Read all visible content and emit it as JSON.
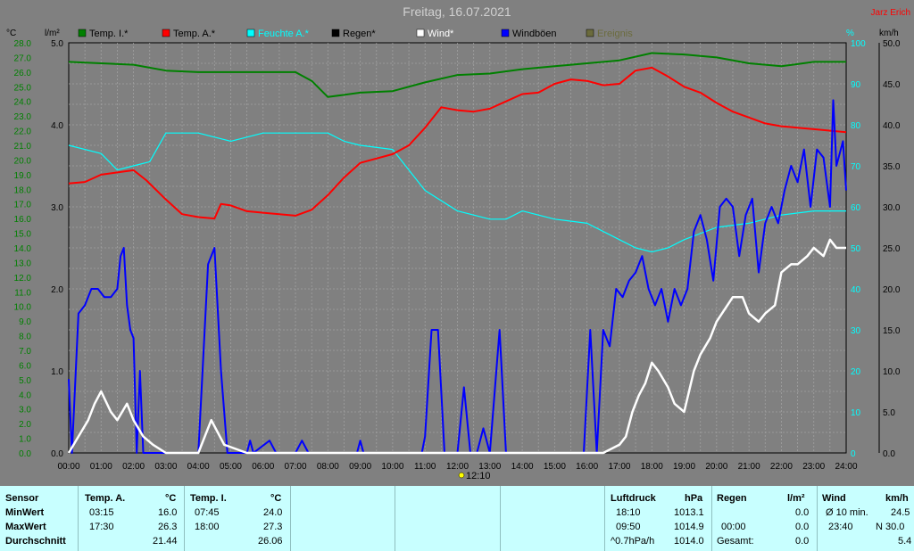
{
  "header": {
    "title": "Freitag, 16.07.2021",
    "author": "Jarz Erich",
    "unit_left_temp": "°C",
    "unit_left_rain": "l/m²",
    "unit_right_hum": "%",
    "unit_right_wind": "km/h",
    "sun_marker": "12:10"
  },
  "colors": {
    "background": "#808080",
    "grid": "#a0a0a0",
    "temp_axis": "#008000",
    "temp_in": "#008000",
    "temp_out": "#ff0000",
    "humidity": "#00ffff",
    "rain": "#000000",
    "wind": "#ffffff",
    "gust": "#0000ff",
    "lightning": "#6b6b3c",
    "table_bg": "#c8ffff"
  },
  "chart_data": {
    "type": "line",
    "legend": [
      "Temp. I.*",
      "Temp. A.*",
      "Feuchte A.*",
      "Regen*",
      "Wind*",
      "Windböen",
      "Ereignis"
    ],
    "x_ticks": [
      "00:00",
      "01:00",
      "02:00",
      "03:00",
      "04:00",
      "05:00",
      "06:00",
      "07:00",
      "08:00",
      "09:00",
      "10:00",
      "11:00",
      "12:00",
      "13:00",
      "14:00",
      "15:00",
      "16:00",
      "17:00",
      "18:00",
      "19:00",
      "20:00",
      "21:00",
      "22:00",
      "23:00",
      "24:00"
    ],
    "temp_ticks": [
      "0.0",
      "1.0",
      "2.0",
      "3.0",
      "4.0",
      "5.0",
      "6.0",
      "7.0",
      "8.0",
      "9.0",
      "10.0",
      "11.0",
      "12.0",
      "13.0",
      "14.0",
      "15.0",
      "16.0",
      "17.0",
      "18.0",
      "19.0",
      "20.0",
      "21.0",
      "22.0",
      "23.0",
      "24.0",
      "25.0",
      "26.0",
      "27.0",
      "28.0"
    ],
    "rain_ticks": [
      "0.0",
      "1.0",
      "2.0",
      "3.0",
      "4.0",
      "5.0"
    ],
    "hum_ticks": [
      "0",
      "10",
      "20",
      "30",
      "40",
      "50",
      "60",
      "70",
      "80",
      "90",
      "100"
    ],
    "wind_ticks": [
      "0.0",
      "5.0",
      "10.0",
      "15.0",
      "20.0",
      "25.0",
      "30.0",
      "35.0",
      "40.0",
      "45.0",
      "50.0"
    ],
    "temp_range": [
      0,
      28
    ],
    "hum_range": [
      0,
      100
    ],
    "wind_range": [
      0,
      50
    ],
    "grid": true,
    "series": [
      {
        "name": "Temp. I.*",
        "axis": "temp",
        "color": "#008000",
        "points": [
          [
            0,
            26.7
          ],
          [
            1,
            26.6
          ],
          [
            2,
            26.5
          ],
          [
            3,
            26.1
          ],
          [
            4,
            26.0
          ],
          [
            5,
            26.0
          ],
          [
            6,
            26.0
          ],
          [
            7,
            26.0
          ],
          [
            7.5,
            25.4
          ],
          [
            8,
            24.3
          ],
          [
            9,
            24.6
          ],
          [
            10,
            24.7
          ],
          [
            11,
            25.3
          ],
          [
            12,
            25.8
          ],
          [
            13,
            25.9
          ],
          [
            14,
            26.2
          ],
          [
            15,
            26.4
          ],
          [
            16,
            26.6
          ],
          [
            17,
            26.8
          ],
          [
            18,
            27.3
          ],
          [
            19,
            27.2
          ],
          [
            20,
            27.0
          ],
          [
            21,
            26.6
          ],
          [
            22,
            26.4
          ],
          [
            23,
            26.7
          ],
          [
            24,
            26.7
          ]
        ]
      },
      {
        "name": "Temp. A.*",
        "axis": "temp",
        "color": "#ff0000",
        "points": [
          [
            0,
            18.4
          ],
          [
            0.5,
            18.5
          ],
          [
            1,
            19.0
          ],
          [
            2,
            19.3
          ],
          [
            2.4,
            18.6
          ],
          [
            3,
            17.3
          ],
          [
            3.5,
            16.3
          ],
          [
            4,
            16.1
          ],
          [
            4.5,
            16.0
          ],
          [
            4.7,
            17.0
          ],
          [
            5,
            16.9
          ],
          [
            5.5,
            16.5
          ],
          [
            6,
            16.4
          ],
          [
            6.5,
            16.3
          ],
          [
            7,
            16.2
          ],
          [
            7.5,
            16.6
          ],
          [
            8,
            17.6
          ],
          [
            8.5,
            18.8
          ],
          [
            9,
            19.8
          ],
          [
            10,
            20.4
          ],
          [
            10.5,
            21.0
          ],
          [
            11,
            22.2
          ],
          [
            11.5,
            23.6
          ],
          [
            12,
            23.4
          ],
          [
            12.5,
            23.3
          ],
          [
            13,
            23.5
          ],
          [
            13.5,
            24.0
          ],
          [
            14,
            24.5
          ],
          [
            14.5,
            24.6
          ],
          [
            15,
            25.2
          ],
          [
            15.5,
            25.5
          ],
          [
            16,
            25.4
          ],
          [
            16.5,
            25.1
          ],
          [
            17,
            25.2
          ],
          [
            17.5,
            26.1
          ],
          [
            18,
            26.3
          ],
          [
            18.5,
            25.7
          ],
          [
            19,
            25.0
          ],
          [
            19.5,
            24.6
          ],
          [
            20,
            23.9
          ],
          [
            20.5,
            23.3
          ],
          [
            21,
            22.9
          ],
          [
            21.5,
            22.5
          ],
          [
            22,
            22.3
          ],
          [
            23,
            22.1
          ],
          [
            24,
            21.9
          ]
        ]
      },
      {
        "name": "Feuchte A.*",
        "axis": "hum",
        "color": "#00ffff",
        "points": [
          [
            0,
            75
          ],
          [
            1,
            73
          ],
          [
            1.5,
            69
          ],
          [
            2,
            70
          ],
          [
            2.5,
            71
          ],
          [
            3,
            78
          ],
          [
            3.5,
            78
          ],
          [
            4,
            78
          ],
          [
            4.5,
            77
          ],
          [
            5,
            76
          ],
          [
            6,
            78
          ],
          [
            7,
            78
          ],
          [
            7.5,
            78
          ],
          [
            8,
            78
          ],
          [
            8.5,
            76
          ],
          [
            9,
            75
          ],
          [
            10,
            74
          ],
          [
            11,
            64
          ],
          [
            12,
            59
          ],
          [
            13,
            57
          ],
          [
            13.5,
            57
          ],
          [
            14,
            59
          ],
          [
            15,
            57
          ],
          [
            16,
            56
          ],
          [
            17,
            52
          ],
          [
            17.5,
            50
          ],
          [
            18,
            49
          ],
          [
            18.5,
            50
          ],
          [
            19,
            52
          ],
          [
            20,
            55
          ],
          [
            21,
            56
          ],
          [
            21.5,
            57
          ],
          [
            22,
            58
          ],
          [
            23,
            59
          ],
          [
            24,
            59
          ]
        ]
      },
      {
        "name": "Wind*",
        "axis": "wind",
        "color": "#ffffff",
        "points": [
          [
            0,
            0
          ],
          [
            0.3,
            2
          ],
          [
            0.6,
            4
          ],
          [
            0.8,
            6
          ],
          [
            1,
            7.5
          ],
          [
            1.3,
            5
          ],
          [
            1.5,
            4
          ],
          [
            1.8,
            6
          ],
          [
            2,
            4
          ],
          [
            2.3,
            2
          ],
          [
            2.6,
            1
          ],
          [
            3,
            0
          ],
          [
            4,
            0
          ],
          [
            4.4,
            4
          ],
          [
            4.8,
            1
          ],
          [
            5.5,
            0
          ],
          [
            16.5,
            0
          ],
          [
            17,
            1
          ],
          [
            17.2,
            2
          ],
          [
            17.4,
            5
          ],
          [
            17.6,
            7
          ],
          [
            17.8,
            8.5
          ],
          [
            18,
            11
          ],
          [
            18.2,
            10
          ],
          [
            18.5,
            8
          ],
          [
            18.7,
            6
          ],
          [
            19,
            5
          ],
          [
            19.3,
            10
          ],
          [
            19.5,
            12
          ],
          [
            19.8,
            14
          ],
          [
            20,
            16
          ],
          [
            20.5,
            19
          ],
          [
            20.8,
            19
          ],
          [
            21,
            17
          ],
          [
            21.3,
            16
          ],
          [
            21.5,
            17
          ],
          [
            21.8,
            18
          ],
          [
            22,
            22
          ],
          [
            22.3,
            23
          ],
          [
            22.5,
            23
          ],
          [
            22.8,
            24
          ],
          [
            23,
            25
          ],
          [
            23.3,
            24
          ],
          [
            23.5,
            26
          ],
          [
            23.7,
            25
          ],
          [
            24,
            25
          ]
        ]
      },
      {
        "name": "Windböen",
        "axis": "wind",
        "color": "#0000ff",
        "points": [
          [
            0,
            9
          ],
          [
            0.1,
            0
          ],
          [
            0.3,
            17
          ],
          [
            0.5,
            18
          ],
          [
            0.7,
            20
          ],
          [
            0.9,
            20
          ],
          [
            1.1,
            19
          ],
          [
            1.3,
            19
          ],
          [
            1.5,
            20
          ],
          [
            1.6,
            24
          ],
          [
            1.7,
            25
          ],
          [
            1.8,
            18
          ],
          [
            1.9,
            15
          ],
          [
            2,
            14
          ],
          [
            2.1,
            0
          ],
          [
            2.2,
            10
          ],
          [
            2.3,
            0
          ],
          [
            4,
            0
          ],
          [
            4.3,
            23
          ],
          [
            4.5,
            25
          ],
          [
            4.7,
            10
          ],
          [
            4.9,
            0
          ],
          [
            5.5,
            0
          ],
          [
            5.6,
            1.5
          ],
          [
            5.7,
            0
          ],
          [
            6.2,
            1.5
          ],
          [
            6.4,
            0
          ],
          [
            7,
            0
          ],
          [
            7.2,
            1.5
          ],
          [
            7.4,
            0
          ],
          [
            8.9,
            0
          ],
          [
            9,
            1.5
          ],
          [
            9.1,
            0
          ],
          [
            10.9,
            0
          ],
          [
            11,
            2
          ],
          [
            11.2,
            15
          ],
          [
            11.4,
            15
          ],
          [
            11.6,
            0
          ],
          [
            12,
            0
          ],
          [
            12.2,
            8
          ],
          [
            12.4,
            0
          ],
          [
            12.6,
            0
          ],
          [
            12.8,
            3
          ],
          [
            13,
            0
          ],
          [
            13.3,
            15
          ],
          [
            13.5,
            0
          ],
          [
            15.9,
            0
          ],
          [
            16.1,
            15
          ],
          [
            16.3,
            0
          ],
          [
            16.5,
            15
          ],
          [
            16.7,
            13
          ],
          [
            16.9,
            20
          ],
          [
            17.1,
            19
          ],
          [
            17.3,
            21
          ],
          [
            17.5,
            22
          ],
          [
            17.7,
            24
          ],
          [
            17.9,
            20
          ],
          [
            18.1,
            18
          ],
          [
            18.3,
            20
          ],
          [
            18.5,
            16
          ],
          [
            18.7,
            20
          ],
          [
            18.9,
            18
          ],
          [
            19.1,
            20
          ],
          [
            19.3,
            27
          ],
          [
            19.5,
            29
          ],
          [
            19.7,
            26
          ],
          [
            19.9,
            21
          ],
          [
            20.1,
            30
          ],
          [
            20.3,
            31
          ],
          [
            20.5,
            30
          ],
          [
            20.7,
            24
          ],
          [
            20.9,
            29
          ],
          [
            21.1,
            31
          ],
          [
            21.3,
            22
          ],
          [
            21.5,
            28
          ],
          [
            21.7,
            30
          ],
          [
            21.9,
            28
          ],
          [
            22.1,
            32
          ],
          [
            22.3,
            35
          ],
          [
            22.5,
            33
          ],
          [
            22.7,
            37
          ],
          [
            22.9,
            30
          ],
          [
            23.1,
            37
          ],
          [
            23.3,
            36
          ],
          [
            23.5,
            30
          ],
          [
            23.6,
            43
          ],
          [
            23.7,
            35
          ],
          [
            23.9,
            38
          ],
          [
            24,
            32
          ]
        ]
      }
    ]
  },
  "table": {
    "sensor_label": "Sensor",
    "rows": [
      "MinWert",
      "MaxWert",
      "Durchschnitt"
    ],
    "temp_a": {
      "title": "Temp. A.",
      "unit": "°C",
      "min_time": "03:15",
      "min_val": "16.0",
      "max_time": "17:30",
      "max_val": "26.3",
      "avg": "21.44"
    },
    "temp_i": {
      "title": "Temp. I.",
      "unit": "°C",
      "min_time": "07:45",
      "min_val": "24.0",
      "max_time": "18:00",
      "max_val": "27.3",
      "avg": "26.06"
    },
    "pressure": {
      "title": "Luftdruck",
      "unit": "hPa",
      "min_time": "18:10",
      "min_val": "1013.1",
      "max_time": "09:50",
      "max_val": "1014.9",
      "trend_label": "^0.7hPa/h",
      "trend_val": "1014.0"
    },
    "rain": {
      "title": "Regen",
      "unit": "l/m²",
      "min_time": "",
      "min_val": "0.0",
      "max_time": "00:00",
      "max_val": "0.0",
      "total_label": "Gesamt:",
      "total_val": "0.0"
    },
    "wind": {
      "title": "Wind",
      "unit": "km/h",
      "min_time": "Ø 10 min.",
      "min_val": "24.5",
      "max_time": "23:40",
      "max_val": "N 30.0",
      "avg": "5.4"
    }
  }
}
